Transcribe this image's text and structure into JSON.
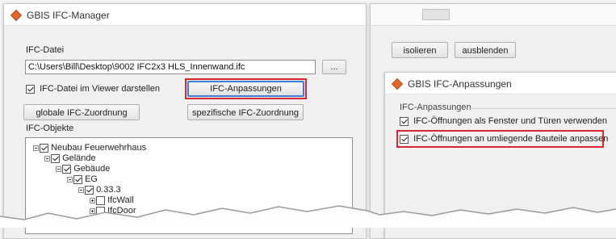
{
  "left_window": {
    "title": "GBIS IFC-Manager",
    "ifc_file_label": "IFC-Datei",
    "ifc_file_path": "C:\\Users\\Bill\\Desktop\\9002 IFC2x3 HLS_Innenwand.ifc",
    "browse_label": "...",
    "show_in_viewer_label": "IFC-Datei im Viewer darstellen",
    "show_in_viewer_checked": true,
    "ifc_adjustments_button": "IFC-Anpassungen",
    "global_assignment_button": "globale IFC-Zuordnung",
    "specific_assignment_button": "spezifische IFC-Zuordnung",
    "ifc_objects_label": "IFC-Objekte",
    "tree": [
      {
        "label": "Neubau Feuerwehrhaus",
        "checked": true,
        "expander": "minus"
      },
      {
        "label": "Gelände",
        "checked": true,
        "expander": "minus"
      },
      {
        "label": "Gebäude",
        "checked": true,
        "expander": "minus"
      },
      {
        "label": "EG",
        "checked": true,
        "expander": "minus"
      },
      {
        "label": "0.33.3",
        "checked": true,
        "expander": "minus"
      },
      {
        "label": "IfcWall",
        "checked": false,
        "expander": "plus"
      },
      {
        "label": "IfcDoor",
        "checked": false,
        "expander": "plus"
      }
    ]
  },
  "right_panel": {
    "isolate_button": "isolieren",
    "hide_button": "ausblenden"
  },
  "dialog": {
    "title": "GBIS IFC-Anpassungen",
    "group_label": "IFC-Anpassungen",
    "option1_label": "IFC-Öffnungen als Fenster und Türen verwenden",
    "option1_checked": true,
    "option2_label": "IFC-Öffnungen an umliegende Bauteile anpassen",
    "option2_checked": true
  },
  "colors": {
    "highlight_red": "#d9262e",
    "focus_blue": "#3c7fd6",
    "icon_orange": "#e0682a"
  }
}
